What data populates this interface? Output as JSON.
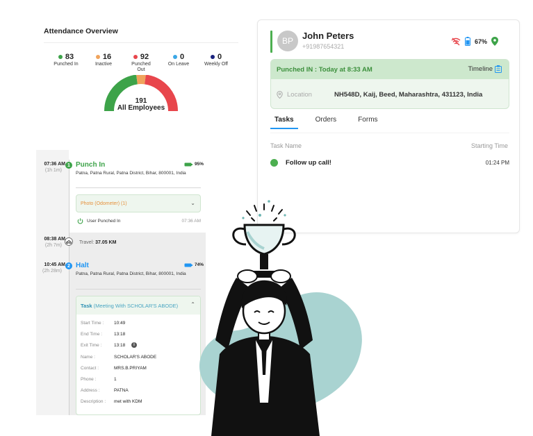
{
  "attendance": {
    "title": "Attendance Overview",
    "stats": [
      {
        "value": "83",
        "label": "Punched In",
        "color": "#3da349"
      },
      {
        "value": "16",
        "label": "Inactive",
        "color": "#f0a35c"
      },
      {
        "value": "92",
        "label": "Punched Out",
        "color": "#e8464c"
      },
      {
        "value": "0",
        "label": "On Leave",
        "color": "#3ba7e6"
      },
      {
        "value": "0",
        "label": "Weekly Off",
        "color": "#1a237e"
      }
    ],
    "total_value": "191",
    "total_label": "All Employees"
  },
  "employee": {
    "initials": "BP",
    "name": "John Peters",
    "phone": "+91987654321",
    "battery": "67%",
    "punched_in_text": "Punched IN : Today at 8:33 AM",
    "timeline_label": "Timeline",
    "location_label": "Location",
    "location_address": "NH548D, Kaij, Beed, Maharashtra, 431123, India",
    "tabs": [
      "Tasks",
      "Orders",
      "Forms"
    ],
    "task_header_name": "Task Name",
    "task_header_time": "Starting Time",
    "tasks": [
      {
        "name": "Follow up call!",
        "time": "01:24 PM"
      }
    ]
  },
  "timeline": {
    "punch_in": {
      "time": "07:36 AM",
      "duration": "(1h 1m)",
      "badge": "1",
      "title": "Punch In",
      "battery": "95%",
      "address": "Patna, Patna Rural, Patna District, Bihar, 800001, India",
      "photo_label": "Photo (Odometer) (1)",
      "user_punched": "User Punched In",
      "user_punched_time": "07:36 AM"
    },
    "travel": {
      "time": "08:38 AM",
      "duration": "(2h 7m)",
      "label": "Travel:",
      "distance": "37.05 KM"
    },
    "halt": {
      "time": "10:45 AM",
      "duration": "(2h 28m)",
      "badge": "2",
      "title": "Halt",
      "battery": "74%",
      "address": "Patna, Patna Rural, Patna District, Bihar, 800001, India",
      "task_label": "Task",
      "task_detail": "(Meeting With SCHOLAR'S ABODE)",
      "fields": [
        {
          "key": "Start Time :",
          "value": "10:49"
        },
        {
          "key": "End Time :",
          "value": "13:18"
        },
        {
          "key": "Exit Time :",
          "value": "13:18"
        },
        {
          "key": "Name :",
          "value": "SCHOLAR'S ABODE"
        },
        {
          "key": "Contact :",
          "value": "MRS.B.PRIYAM"
        },
        {
          "key": "Phone :",
          "value": "1"
        },
        {
          "key": "Address :",
          "value": "PATNA"
        },
        {
          "key": "Description :",
          "value": "met with KDM"
        }
      ]
    }
  },
  "colors": {
    "green": "#4caf50",
    "orange": "#f0a35c",
    "red": "#e8464c",
    "blue": "#2196f3",
    "teal_blob": "#a9d3d1"
  }
}
